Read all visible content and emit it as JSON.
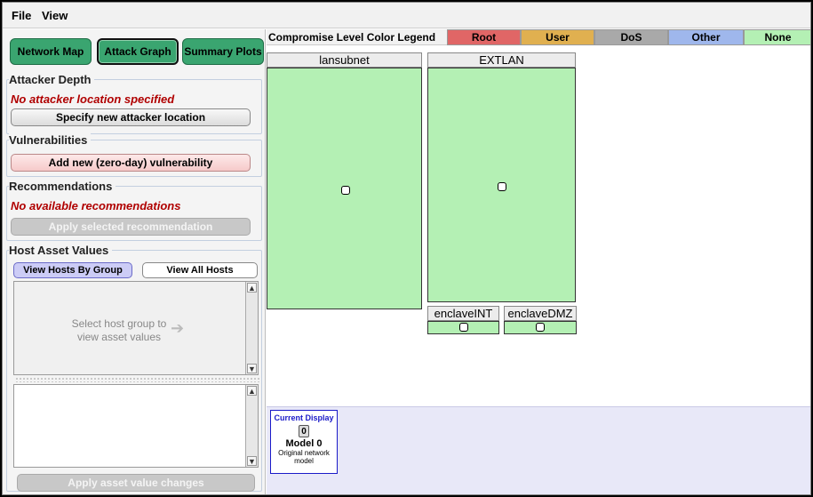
{
  "menu": {
    "file": "File",
    "view": "View"
  },
  "tabs": [
    {
      "label": "Network Map",
      "active": false
    },
    {
      "label": "Attack Graph",
      "active": true
    },
    {
      "label": "Summary Plots",
      "active": false
    }
  ],
  "attacker_depth": {
    "title": "Attacker Depth",
    "warning": "No attacker location specified",
    "button": "Specify new attacker location"
  },
  "vulnerabilities": {
    "title": "Vulnerabilities",
    "button": "Add new (zero-day) vulnerability"
  },
  "recommendations": {
    "title": "Recommendations",
    "warning": "No available recommendations",
    "button": "Apply selected recommendation"
  },
  "host_assets": {
    "title": "Host Asset Values",
    "view_by_group": "View Hosts By Group",
    "view_all": "View All Hosts",
    "hint": "Select host group to view asset values",
    "apply_button": "Apply asset value changes"
  },
  "legend": {
    "title": "Compromise Level Color Legend",
    "items": [
      {
        "label": "Root",
        "color": "#e06666"
      },
      {
        "label": "User",
        "color": "#e0b050"
      },
      {
        "label": "DoS",
        "color": "#a9a9a9"
      },
      {
        "label": "Other",
        "color": "#9fb7ec"
      },
      {
        "label": "None",
        "color": "#b4f0b4"
      }
    ]
  },
  "subnets": [
    {
      "name": "lansubnet",
      "color": "#b4f0b4"
    },
    {
      "name": "EXTLAN",
      "color": "#b4f0b4"
    },
    {
      "name": "enclaveINT",
      "color": "#b4f0b4"
    },
    {
      "name": "enclaveDMZ",
      "color": "#b4f0b4"
    }
  ],
  "model_card": {
    "caption": "Current Display",
    "number": "0",
    "name": "Model 0",
    "description": "Original network model"
  }
}
